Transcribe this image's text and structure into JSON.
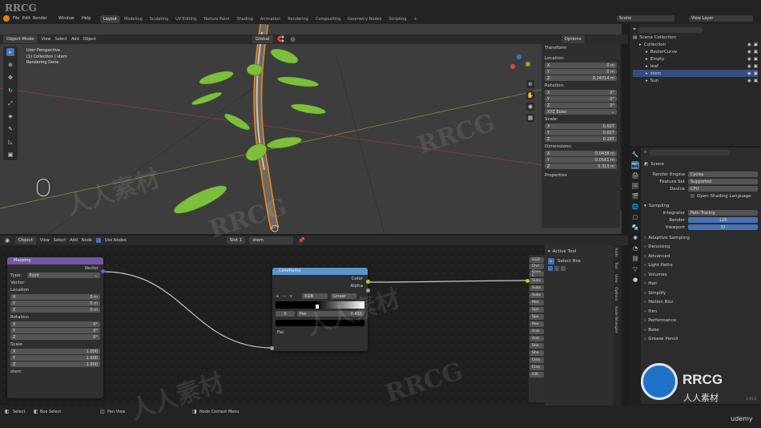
{
  "menu": {
    "items": [
      "File",
      "Edit",
      "Render",
      "Window",
      "Help"
    ],
    "tabs": [
      "Layout",
      "Modeling",
      "Sculpting",
      "UV Editing",
      "Texture Paint",
      "Shading",
      "Animation",
      "Rendering",
      "Compositing",
      "Geometry Nodes",
      "Scripting"
    ],
    "active_tab": "Layout",
    "plus": "+",
    "scene": "Scene",
    "view_layer": "View Layer"
  },
  "viewport": {
    "mode": "Object Mode",
    "menus": [
      "View",
      "Select",
      "Add",
      "Object"
    ],
    "orientation": "Global",
    "options": "Options",
    "overlay_lines": [
      "User Perspective",
      "(1) Collection | stem",
      "Rendering Done"
    ]
  },
  "npanel": {
    "title": "Transform",
    "location_label": "Location:",
    "location": [
      {
        "axis": "X",
        "value": "0 m"
      },
      {
        "axis": "Y",
        "value": "0 m"
      },
      {
        "axis": "Z",
        "value": "0.24714 m"
      }
    ],
    "rotation_label": "Rotation:",
    "rotation": [
      {
        "axis": "X",
        "value": "0°"
      },
      {
        "axis": "Y",
        "value": "0°"
      },
      {
        "axis": "Z",
        "value": "0°"
      }
    ],
    "euler": "XYZ Euler",
    "scale_label": "Scale:",
    "scale": [
      {
        "axis": "X",
        "value": "0.027"
      },
      {
        "axis": "Y",
        "value": "0.027"
      },
      {
        "axis": "Z",
        "value": "0.187"
      }
    ],
    "dims_label": "Dimensions:",
    "dims": [
      {
        "axis": "X",
        "value": "0.0438 m"
      },
      {
        "axis": "Y",
        "value": "0.0161 m"
      },
      {
        "axis": "Z",
        "value": "0.313 m"
      }
    ],
    "properties": "Properties",
    "vtabs": [
      "Item",
      "Tool",
      "View",
      "Edit",
      "Create",
      "Fluid",
      "Easy",
      "ARM Lib",
      "Screencast",
      "LoopTools/Hdri"
    ]
  },
  "outliner": {
    "root": "Scene Collection",
    "items": [
      {
        "name": "Collection",
        "indent": 1
      },
      {
        "name": "BezierCurve",
        "indent": 2
      },
      {
        "name": "Empty",
        "indent": 2
      },
      {
        "name": "leaf",
        "indent": 2
      },
      {
        "name": "stem",
        "indent": 2,
        "selected": true
      },
      {
        "name": "Sun",
        "indent": 2
      }
    ]
  },
  "props": {
    "search": "",
    "scene_label": "Scene",
    "engine_label": "Render Engine",
    "engine": "Cycles",
    "feature_label": "Feature Set",
    "feature": "Supported",
    "device_label": "Device",
    "device": "CPU",
    "osl": "Open Shading Language",
    "sampling": "Sampling",
    "integrator_label": "Integrator",
    "integrator": "Path Tracing",
    "render_label": "Render",
    "render": "128",
    "viewport_label": "Viewport",
    "viewport": "32",
    "sections": [
      "Adaptive Sampling",
      "Denoising",
      "Advanced",
      "Light Paths",
      "Volumes",
      "Hair",
      "Simplify",
      "Motion Blur",
      "Film",
      "Performance",
      "Bake",
      "Grease Pencil"
    ],
    "version": "2.93.0"
  },
  "node_editor": {
    "type": "Object",
    "menus": [
      "View",
      "Select",
      "Add",
      "Node"
    ],
    "use_nodes": "Use Nodes",
    "slot": "Slot 1",
    "material": "stem",
    "side_title": "Active Tool",
    "tool": "Select Box",
    "side_vtabs": [
      "Node",
      "Tool",
      "View",
      "Options",
      "Node Wrangler"
    ],
    "bsdf_partial": [
      "GGX",
      "Chri"
    ],
    "bsdf_rows": [
      "Base C",
      "Subs",
      "Subs",
      "Subs",
      "Met",
      "Spe",
      "Spe",
      "Rou",
      "Anis",
      "Anis",
      "She",
      "She",
      "Clea",
      "Clea",
      "IOR"
    ]
  },
  "mapping": {
    "title": "Mapping",
    "out": "Vector",
    "type_label": "Type:",
    "type": "Point",
    "in_vector": "Vector",
    "location_label": "Location",
    "location": [
      {
        "axis": "X",
        "value": "0 m"
      },
      {
        "axis": "Y",
        "value": "0 m"
      },
      {
        "axis": "Z",
        "value": "0 m"
      }
    ],
    "rotation_label": "Rotation",
    "rotation": [
      {
        "axis": "X",
        "value": "0°"
      },
      {
        "axis": "Y",
        "value": "0°"
      },
      {
        "axis": "Z",
        "value": "0°"
      }
    ],
    "scale_label": "Scale",
    "scale": [
      {
        "axis": "X",
        "value": "1.000"
      },
      {
        "axis": "Y",
        "value": "1.000"
      },
      {
        "axis": "Z",
        "value": "1.000"
      }
    ],
    "footer": "stem"
  },
  "colorramp": {
    "title": "ColorRamp",
    "out_color": "Color",
    "out_alpha": "Alpha",
    "mode": "RGB",
    "interp": "Linear",
    "index": "0",
    "pos_label": "Pos",
    "pos": "0.455",
    "in_fac": "Fac",
    "plus": "+",
    "minus": "−",
    "chev": "∨"
  },
  "status": {
    "items": [
      "Select",
      "Box Select",
      "Pan View",
      "Node Context Menu"
    ]
  },
  "watermark": {
    "tl": "RRCG",
    "mid": [
      "RRCG",
      "人人素材"
    ],
    "logo_main": "RRCG",
    "logo_sub": "人人素材",
    "udemy": "udemy"
  },
  "colors": {
    "accent": "#4772b3",
    "mapping": "#7356a6",
    "colorramp": "#5a95c9",
    "selected_outline": "#f08a24",
    "leaf": "#7cbf3c"
  }
}
